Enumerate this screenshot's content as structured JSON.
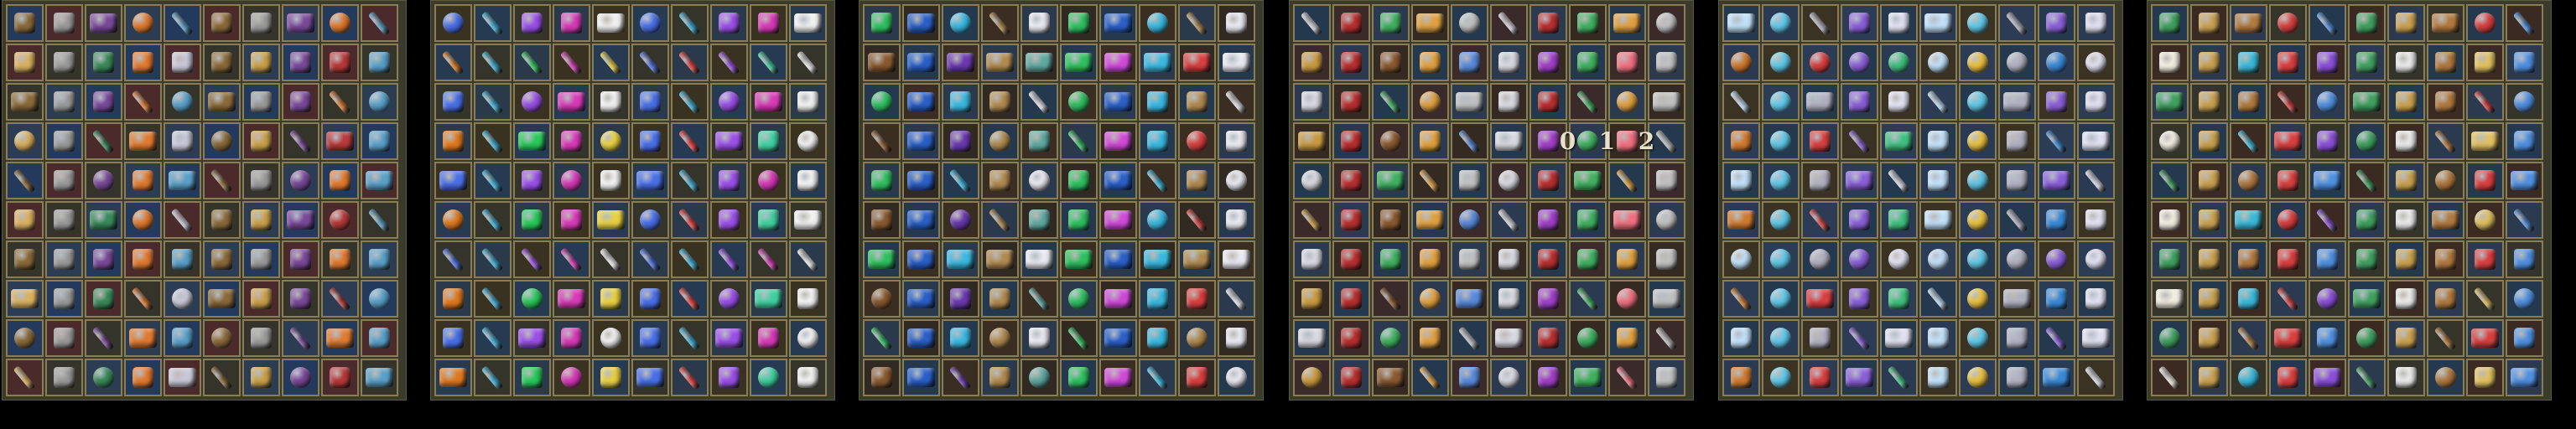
{
  "grid": {
    "cols": 10,
    "rows": 10
  },
  "sheets": [
    {
      "name": "sheet-misc-relics",
      "tints": [
        "#243a5c",
        "#4a2a2a",
        "#34342a",
        "#2c3c52"
      ],
      "icons": [
        "#8b6a3a",
        "#c9a04a",
        "#7a4a9a",
        "#b83a3a",
        "#5aa0c8",
        "#d8b060",
        "#9a9a9a",
        "#3a8a5a",
        "#e07a30",
        "#c8c8d8"
      ]
    },
    {
      "name": "sheet-gifts-pumpkins",
      "tints": [
        "#2a3a4a",
        "#3a3220",
        "#263a52",
        "#34342a"
      ],
      "icons": [
        "#e07a20",
        "#3ab0d8",
        "#2ac85a",
        "#d83ab8",
        "#e8d040",
        "#4a70e8",
        "#e84040",
        "#9a50e8",
        "#40d0a0",
        "#f0f0f0"
      ]
    },
    {
      "name": "sheet-potions-books",
      "tints": [
        "#24384e",
        "#3a2e22",
        "#2a3a4c",
        "#302a22"
      ],
      "icons": [
        "#30c060",
        "#d04ad8",
        "#3ab8e0",
        "#d84040",
        "#e8e8f0",
        "#8a5a30",
        "#2a60c8",
        "#6a3ab0",
        "#b08a50",
        "#60a8a0"
      ]
    },
    {
      "name": "sheet-armor-jewelry",
      "tints": [
        "#3a2a2a",
        "#2c3a50",
        "#342a22",
        "#24384e"
      ],
      "icons": [
        "#c89a40",
        "#b83030",
        "#8a5a30",
        "#e0a040",
        "#5a8ad8",
        "#d8d8e0",
        "#a040c8",
        "#40b060",
        "#f07080",
        "#c0c0c0"
      ]
    },
    {
      "name": "sheet-crystals-rings",
      "tints": [
        "#24384e",
        "#2a3a52",
        "#3a3222",
        "#2c3c54"
      ],
      "icons": [
        "#c0e0f8",
        "#e8c040",
        "#b0b0c0",
        "#3a8ad8",
        "#e0e0f0",
        "#d07a30",
        "#60c8e8",
        "#d84040",
        "#8a60d8",
        "#40c080"
      ]
    },
    {
      "name": "sheet-eggs-orbs",
      "tints": [
        "#34342a",
        "#24384e",
        "#3a2a22",
        "#2c3a50"
      ],
      "icons": [
        "#f0ece0",
        "#c8a050",
        "#3ab8d8",
        "#d84040",
        "#8a50d8",
        "#40a060",
        "#e8e8e8",
        "#b07a40",
        "#e0c060",
        "#5090e0"
      ]
    }
  ],
  "special_text": {
    "digits": [
      "0",
      "1",
      "2"
    ]
  }
}
